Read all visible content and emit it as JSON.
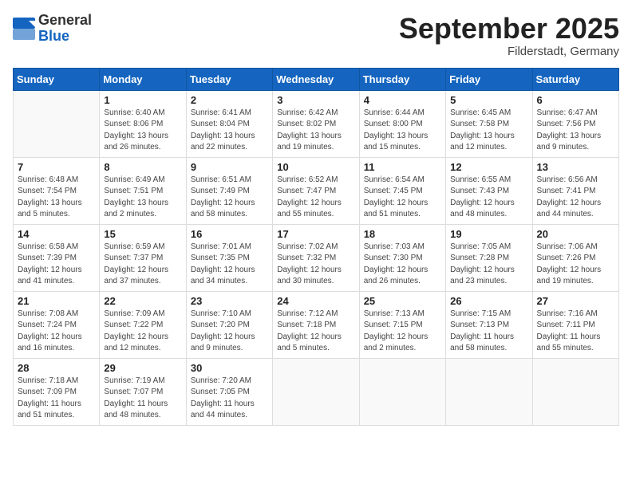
{
  "header": {
    "logo_general": "General",
    "logo_blue": "Blue",
    "month_title": "September 2025",
    "location": "Filderstadt, Germany"
  },
  "weekdays": [
    "Sunday",
    "Monday",
    "Tuesday",
    "Wednesday",
    "Thursday",
    "Friday",
    "Saturday"
  ],
  "weeks": [
    [
      {
        "day": "",
        "info": ""
      },
      {
        "day": "1",
        "info": "Sunrise: 6:40 AM\nSunset: 8:06 PM\nDaylight: 13 hours\nand 26 minutes."
      },
      {
        "day": "2",
        "info": "Sunrise: 6:41 AM\nSunset: 8:04 PM\nDaylight: 13 hours\nand 22 minutes."
      },
      {
        "day": "3",
        "info": "Sunrise: 6:42 AM\nSunset: 8:02 PM\nDaylight: 13 hours\nand 19 minutes."
      },
      {
        "day": "4",
        "info": "Sunrise: 6:44 AM\nSunset: 8:00 PM\nDaylight: 13 hours\nand 15 minutes."
      },
      {
        "day": "5",
        "info": "Sunrise: 6:45 AM\nSunset: 7:58 PM\nDaylight: 13 hours\nand 12 minutes."
      },
      {
        "day": "6",
        "info": "Sunrise: 6:47 AM\nSunset: 7:56 PM\nDaylight: 13 hours\nand 9 minutes."
      }
    ],
    [
      {
        "day": "7",
        "info": "Sunrise: 6:48 AM\nSunset: 7:54 PM\nDaylight: 13 hours\nand 5 minutes."
      },
      {
        "day": "8",
        "info": "Sunrise: 6:49 AM\nSunset: 7:51 PM\nDaylight: 13 hours\nand 2 minutes."
      },
      {
        "day": "9",
        "info": "Sunrise: 6:51 AM\nSunset: 7:49 PM\nDaylight: 12 hours\nand 58 minutes."
      },
      {
        "day": "10",
        "info": "Sunrise: 6:52 AM\nSunset: 7:47 PM\nDaylight: 12 hours\nand 55 minutes."
      },
      {
        "day": "11",
        "info": "Sunrise: 6:54 AM\nSunset: 7:45 PM\nDaylight: 12 hours\nand 51 minutes."
      },
      {
        "day": "12",
        "info": "Sunrise: 6:55 AM\nSunset: 7:43 PM\nDaylight: 12 hours\nand 48 minutes."
      },
      {
        "day": "13",
        "info": "Sunrise: 6:56 AM\nSunset: 7:41 PM\nDaylight: 12 hours\nand 44 minutes."
      }
    ],
    [
      {
        "day": "14",
        "info": "Sunrise: 6:58 AM\nSunset: 7:39 PM\nDaylight: 12 hours\nand 41 minutes."
      },
      {
        "day": "15",
        "info": "Sunrise: 6:59 AM\nSunset: 7:37 PM\nDaylight: 12 hours\nand 37 minutes."
      },
      {
        "day": "16",
        "info": "Sunrise: 7:01 AM\nSunset: 7:35 PM\nDaylight: 12 hours\nand 34 minutes."
      },
      {
        "day": "17",
        "info": "Sunrise: 7:02 AM\nSunset: 7:32 PM\nDaylight: 12 hours\nand 30 minutes."
      },
      {
        "day": "18",
        "info": "Sunrise: 7:03 AM\nSunset: 7:30 PM\nDaylight: 12 hours\nand 26 minutes."
      },
      {
        "day": "19",
        "info": "Sunrise: 7:05 AM\nSunset: 7:28 PM\nDaylight: 12 hours\nand 23 minutes."
      },
      {
        "day": "20",
        "info": "Sunrise: 7:06 AM\nSunset: 7:26 PM\nDaylight: 12 hours\nand 19 minutes."
      }
    ],
    [
      {
        "day": "21",
        "info": "Sunrise: 7:08 AM\nSunset: 7:24 PM\nDaylight: 12 hours\nand 16 minutes."
      },
      {
        "day": "22",
        "info": "Sunrise: 7:09 AM\nSunset: 7:22 PM\nDaylight: 12 hours\nand 12 minutes."
      },
      {
        "day": "23",
        "info": "Sunrise: 7:10 AM\nSunset: 7:20 PM\nDaylight: 12 hours\nand 9 minutes."
      },
      {
        "day": "24",
        "info": "Sunrise: 7:12 AM\nSunset: 7:18 PM\nDaylight: 12 hours\nand 5 minutes."
      },
      {
        "day": "25",
        "info": "Sunrise: 7:13 AM\nSunset: 7:15 PM\nDaylight: 12 hours\nand 2 minutes."
      },
      {
        "day": "26",
        "info": "Sunrise: 7:15 AM\nSunset: 7:13 PM\nDaylight: 11 hours\nand 58 minutes."
      },
      {
        "day": "27",
        "info": "Sunrise: 7:16 AM\nSunset: 7:11 PM\nDaylight: 11 hours\nand 55 minutes."
      }
    ],
    [
      {
        "day": "28",
        "info": "Sunrise: 7:18 AM\nSunset: 7:09 PM\nDaylight: 11 hours\nand 51 minutes."
      },
      {
        "day": "29",
        "info": "Sunrise: 7:19 AM\nSunset: 7:07 PM\nDaylight: 11 hours\nand 48 minutes."
      },
      {
        "day": "30",
        "info": "Sunrise: 7:20 AM\nSunset: 7:05 PM\nDaylight: 11 hours\nand 44 minutes."
      },
      {
        "day": "",
        "info": ""
      },
      {
        "day": "",
        "info": ""
      },
      {
        "day": "",
        "info": ""
      },
      {
        "day": "",
        "info": ""
      }
    ]
  ]
}
